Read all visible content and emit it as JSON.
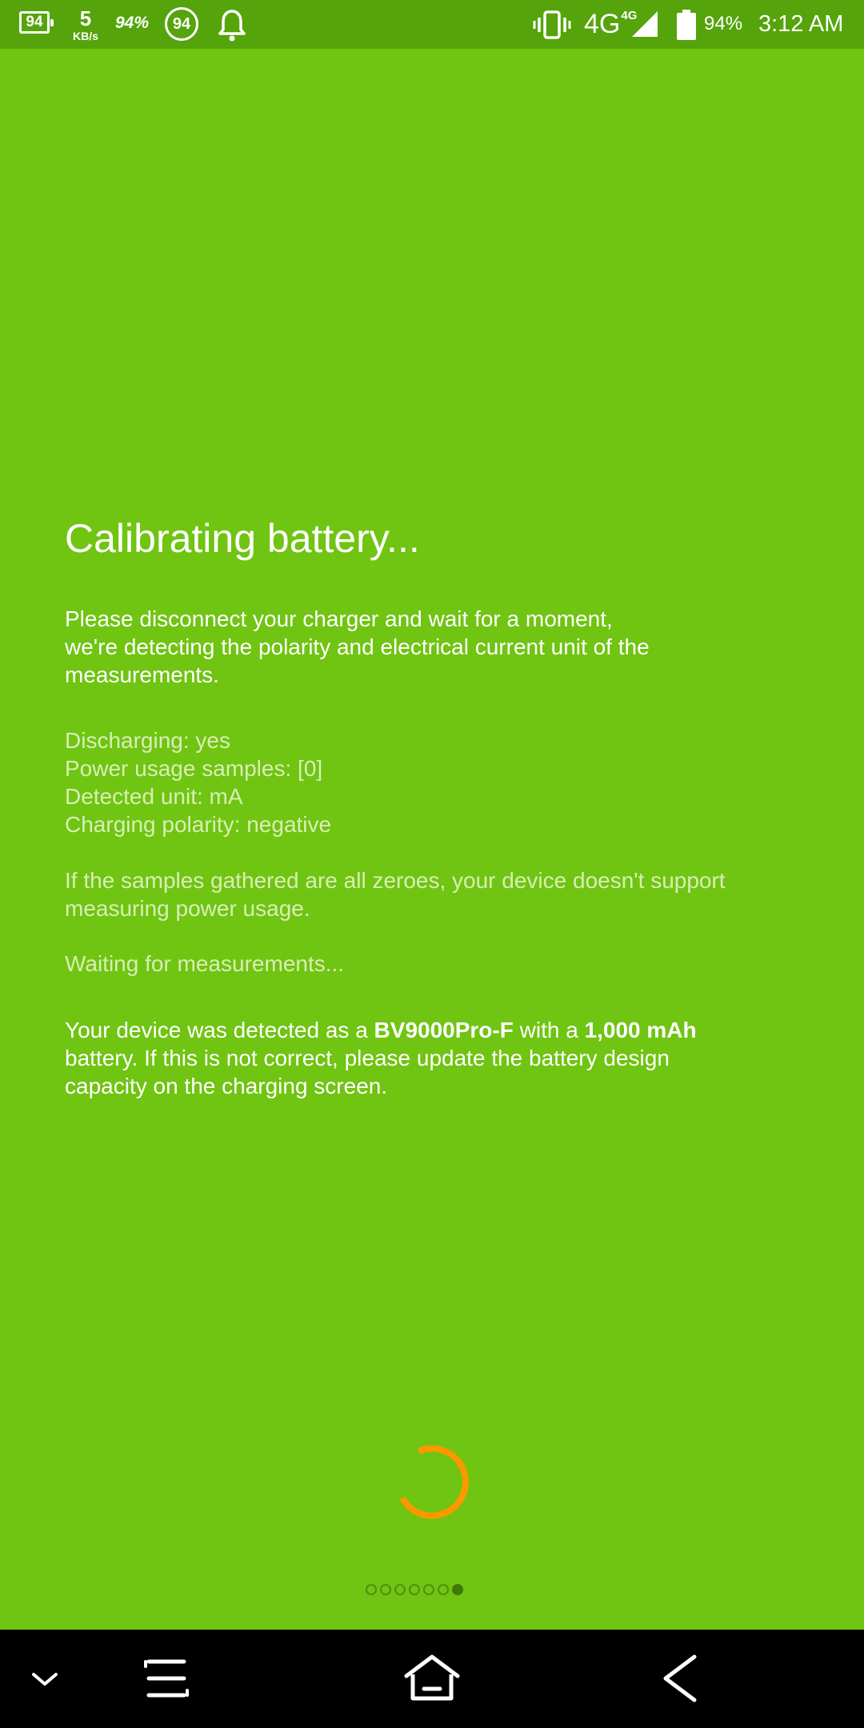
{
  "status_bar": {
    "battery_box_value": "94",
    "net_speed_value": "5",
    "net_speed_unit": "KB/s",
    "battery_pct_italic": "94%",
    "battery_circle_value": "94",
    "network_type": "4G",
    "network_sup": "4G",
    "battery_pct": "94%",
    "time": "3:12 AM",
    "icons": [
      "battery-box-icon",
      "notification-bell-icon",
      "vibrate-icon",
      "signal-strength-icon",
      "battery-icon"
    ]
  },
  "main": {
    "title": "Calibrating battery...",
    "intro": [
      "Please disconnect your charger and wait for a moment,",
      "we're detecting the polarity and electrical current unit of the",
      "measurements."
    ],
    "stats": [
      "Discharging: yes",
      "Power usage samples: [0]",
      "Detected unit: mA",
      "Charging polarity: negative"
    ],
    "note": [
      "If the samples gathered are all zeroes, your device doesn't support",
      "measuring power usage."
    ],
    "waiting": "Waiting for measurements...",
    "device": {
      "prefix": "Your device was detected as a ",
      "model": "BV9000Pro-F",
      "middle": " with a ",
      "capacity": "1,000 mAh",
      "suffix_line1": "",
      "line2": "battery. If this is not correct, please update the battery design",
      "line3": "capacity on the charging screen."
    }
  },
  "pager": {
    "total_pages": 7,
    "active_page": 7
  },
  "nav_bar": {
    "icons": [
      "chevron-down-icon",
      "menu-icon",
      "home-icon",
      "back-icon"
    ]
  },
  "colors": {
    "background": "#70c412",
    "status_bar": "#55a40c",
    "spinner": "#ff9800",
    "secondary_text": "#d8efb5",
    "nav_bar": "#000000"
  }
}
